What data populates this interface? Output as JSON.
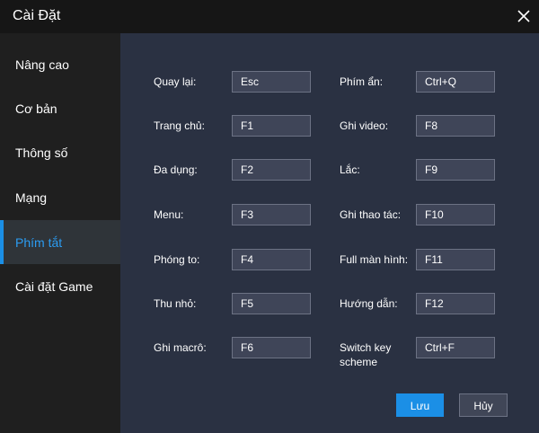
{
  "window": {
    "title": "Cài Đặt"
  },
  "sidebar": {
    "items": [
      {
        "label": "Nâng cao"
      },
      {
        "label": "Cơ bản"
      },
      {
        "label": "Thông số"
      },
      {
        "label": "Mạng"
      },
      {
        "label": "Phím tắt",
        "active": true
      },
      {
        "label": "Cài đặt Game"
      }
    ]
  },
  "shortcuts": {
    "left": [
      {
        "label": "Quay lại:",
        "key": "Esc"
      },
      {
        "label": "Trang chủ:",
        "key": "F1"
      },
      {
        "label": "Đa dụng:",
        "key": "F2"
      },
      {
        "label": "Menu:",
        "key": "F3"
      },
      {
        "label": "Phóng to:",
        "key": "F4"
      },
      {
        "label": "Thu nhỏ:",
        "key": "F5"
      },
      {
        "label": "Ghi macrô:",
        "key": "F6"
      }
    ],
    "right": [
      {
        "label": "Phím ẩn:",
        "key": "Ctrl+Q"
      },
      {
        "label": "Ghi video:",
        "key": "F8"
      },
      {
        "label": "Lắc:",
        "key": "F9"
      },
      {
        "label": "Ghi thao tác:",
        "key": "F10"
      },
      {
        "label": "Full màn hình:",
        "key": "F11"
      },
      {
        "label": "Hướng dẫn:",
        "key": "F12"
      },
      {
        "label": "Switch key scheme",
        "key": "Ctrl+F"
      }
    ]
  },
  "buttons": {
    "save": "Lưu",
    "cancel": "Hủy"
  },
  "colors": {
    "accent": "#1b8fe6",
    "active_text": "#2b9cf2",
    "panel": "#2a3142",
    "field": "#3f4558"
  },
  "icons": {
    "close": "close-icon"
  }
}
